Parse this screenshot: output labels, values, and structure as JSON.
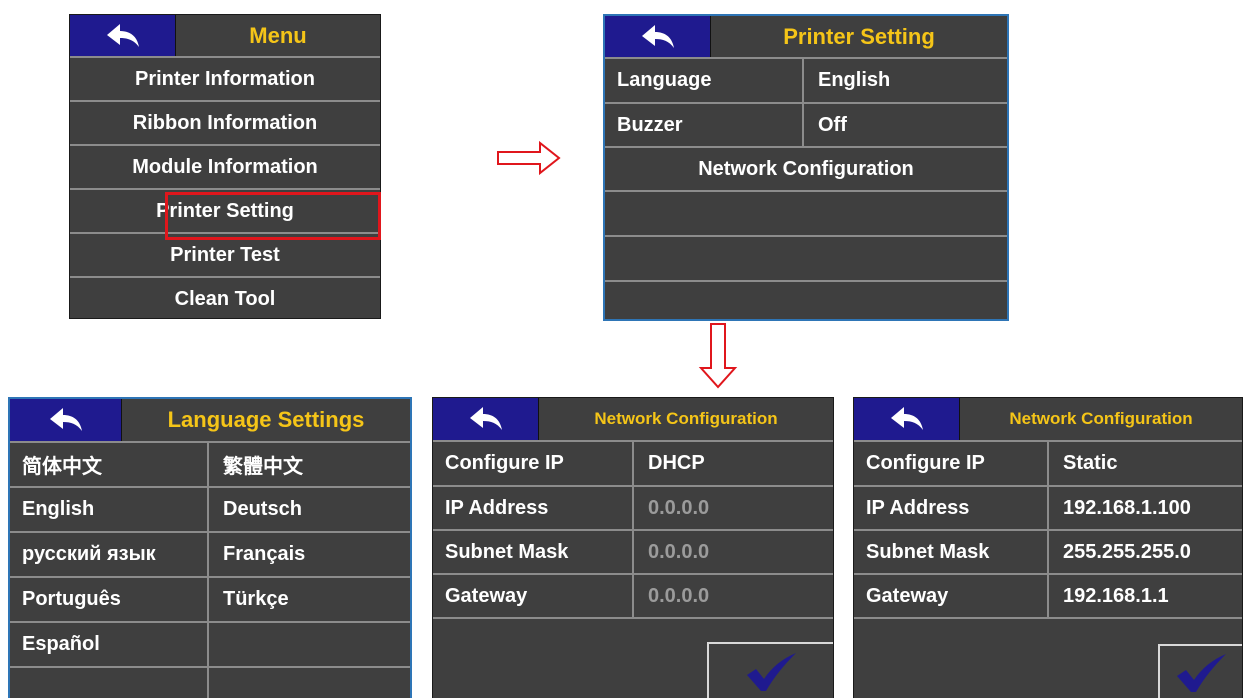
{
  "menu": {
    "title": "Menu",
    "items": [
      {
        "label": "Printer Information"
      },
      {
        "label": "Ribbon Information"
      },
      {
        "label": "Module Information"
      },
      {
        "label": "Printer Setting"
      },
      {
        "label": "Printer Test"
      },
      {
        "label": "Clean Tool"
      }
    ],
    "highlighted_item": "Printer Setting"
  },
  "printer_setting": {
    "title": "Printer Setting",
    "rows": [
      {
        "label": "Language",
        "value": "English"
      },
      {
        "label": "Buzzer",
        "value": "Off"
      }
    ],
    "network_label": "Network Configuration"
  },
  "language_settings": {
    "title": "Language Settings",
    "options": [
      [
        "简体中文",
        "繁體中文"
      ],
      [
        "English",
        "Deutsch"
      ],
      [
        "русский язык",
        "Français"
      ],
      [
        "Português",
        "Türkçe"
      ],
      [
        "Español",
        ""
      ]
    ]
  },
  "network_dhcp": {
    "title": "Network Configuration",
    "rows": [
      {
        "label": "Configure IP",
        "value": "DHCP"
      },
      {
        "label": "IP Address",
        "value": "0.0.0.0"
      },
      {
        "label": "Subnet Mask",
        "value": "0.0.0.0"
      },
      {
        "label": "Gateway",
        "value": "0.0.0.0"
      }
    ]
  },
  "network_static": {
    "title": "Network Configuration",
    "rows": [
      {
        "label": "Configure IP",
        "value": "Static"
      },
      {
        "label": "IP Address",
        "value": "192.168.1.100"
      },
      {
        "label": "Subnet Mask",
        "value": "255.255.255.0"
      },
      {
        "label": "Gateway",
        "value": "192.168.1.1"
      }
    ]
  },
  "colors": {
    "panel_bg": "#3f3f3f",
    "header_back_bg": "#1f1a8f",
    "title_yellow": "#f5c518",
    "highlight_red": "#e0161c",
    "check_blue": "#1f1a8f"
  },
  "icons": {
    "back": "back-arrow-icon",
    "confirm": "checkmark-icon",
    "flow": "hollow-arrow-icon"
  }
}
